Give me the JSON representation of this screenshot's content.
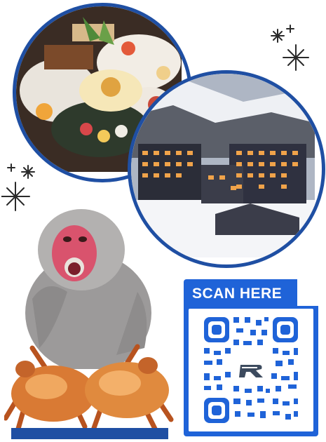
{
  "qr_section": {
    "label": "SCAN HERE",
    "center_logo_icon": "r-logo-icon"
  },
  "images": {
    "food_photo": "kaiseki-meal-photo",
    "hotel_photo": "snowy-resort-hotel-photo",
    "monkey_photo": "snow-monkey-photo",
    "crab_photo": "hairy-crab-photo"
  },
  "colors": {
    "frame_blue": "#1f4fa3",
    "qr_blue": "#1f63d8",
    "sparkle": "#2a2a2a"
  }
}
